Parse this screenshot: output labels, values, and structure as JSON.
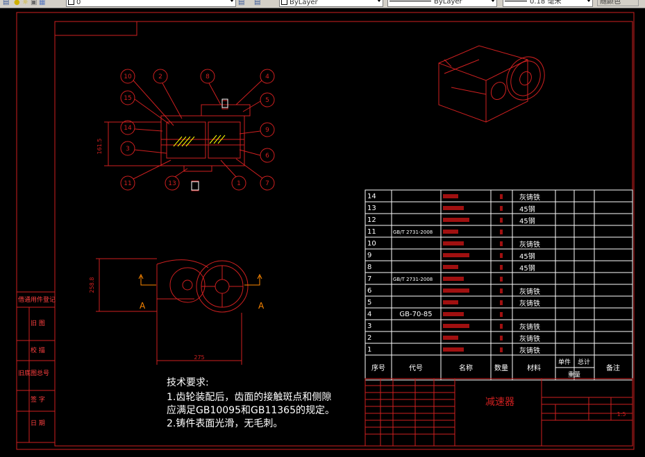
{
  "toolbar": {
    "layer_value": "0",
    "color_value": "ByLayer",
    "linetype_value": "ByLayer",
    "lineweight_value": "0.18 毫米",
    "plotstyle_value": "随颜色"
  },
  "views": {
    "front_callouts": [
      "10",
      "2",
      "8",
      "4",
      "15",
      "5",
      "14",
      "9",
      "3",
      "6",
      "11",
      "13",
      "1",
      "7"
    ],
    "front_dim": "161.5",
    "side_dim_vertical": "258.8",
    "side_dim_horizontal": "275",
    "section_label_left": "A",
    "section_label_right": "A"
  },
  "tech_requirements": {
    "heading": "技术要求:",
    "line1": "1.齿轮装配后，齿面的接触斑点和侧隙",
    "line2": "应满足GB10095和GB11365的规定。",
    "line3": "2.铸件表面光滑，无毛刺。"
  },
  "bom": {
    "rows": [
      {
        "no": "14",
        "code": "",
        "material": "灰铸铁"
      },
      {
        "no": "13",
        "code": "",
        "material": "45钢"
      },
      {
        "no": "12",
        "code": "",
        "material": "45钢"
      },
      {
        "no": "11",
        "code": "GB/T 2731-2008",
        "material": ""
      },
      {
        "no": "10",
        "code": "",
        "material": "灰铸铁"
      },
      {
        "no": "9",
        "code": "",
        "material": "45钢"
      },
      {
        "no": "8",
        "code": "",
        "material": "45钢"
      },
      {
        "no": "7",
        "code": "GB/T 2731-2008",
        "material": ""
      },
      {
        "no": "6",
        "code": "",
        "material": "灰铸铁"
      },
      {
        "no": "5",
        "code": "",
        "material": "灰铸铁"
      },
      {
        "no": "4",
        "code": "GB-70-85",
        "material": ""
      },
      {
        "no": "3",
        "code": "",
        "material": "灰铸铁"
      },
      {
        "no": "2",
        "code": "",
        "material": "灰铸铁"
      },
      {
        "no": "1",
        "code": "",
        "material": "灰铸铁"
      }
    ],
    "headers": {
      "no": "序号",
      "code": "代号",
      "name": "名称",
      "qty": "数量",
      "material": "材料",
      "unit": "单件",
      "total": "总计",
      "weight": "重量",
      "remark": "备注"
    }
  },
  "title_block": {
    "drawing_name": "减速器",
    "scale": "1:5"
  },
  "side_strip": [
    "借通用件登记",
    "旧 图",
    "校 描",
    "旧底图总号",
    "签 字",
    "日 期"
  ],
  "colors": {
    "line": "#d02020",
    "text": "#ffffff",
    "bg": "#000000",
    "hatch": "#ffff00",
    "accent": "#ff8800"
  }
}
